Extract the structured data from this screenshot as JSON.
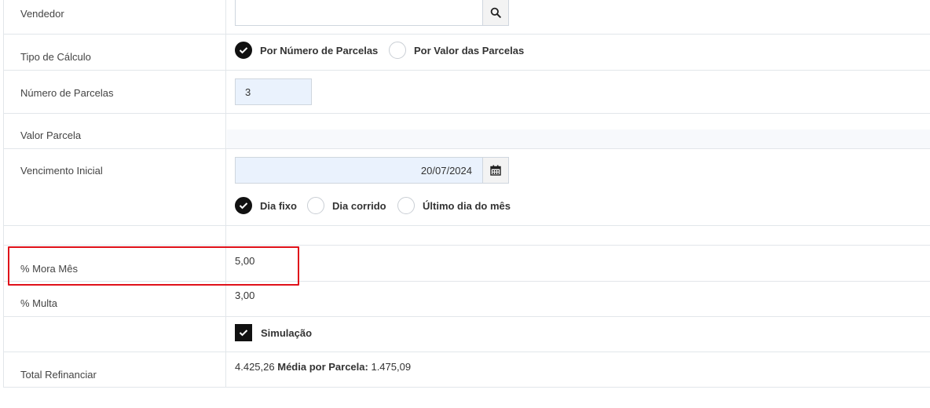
{
  "fields": {
    "vendedor": {
      "label": "Vendedor",
      "value": "",
      "icon": "search-icon"
    },
    "tipo_calculo": {
      "label": "Tipo de Cálculo",
      "options": [
        "Por Número de Parcelas",
        "Por Valor das Parcelas"
      ],
      "selected": "Por Número de Parcelas"
    },
    "numero_parcelas": {
      "label": "Número de Parcelas",
      "value": "3"
    },
    "valor_parcela": {
      "label": "Valor Parcela",
      "value": ""
    },
    "vencimento_inicial": {
      "label": "Vencimento Inicial",
      "value": "20/07/2024",
      "icon": "calendar-icon",
      "options": [
        "Dia fixo",
        "Dia corrido",
        "Último dia do mês"
      ],
      "selected": "Dia fixo"
    },
    "mora_mes": {
      "label": "% Mora Mês",
      "value": "5,00"
    },
    "multa": {
      "label": "% Multa",
      "value": "3,00"
    },
    "simulacao": {
      "label": "Simulação",
      "checked": true
    },
    "total_refinanciar": {
      "label": "Total Refinanciar",
      "value": "4.425,26",
      "media_label": "Média por Parcela:",
      "media_value": "1.475,09"
    }
  },
  "highlight_color": "#e0111a"
}
